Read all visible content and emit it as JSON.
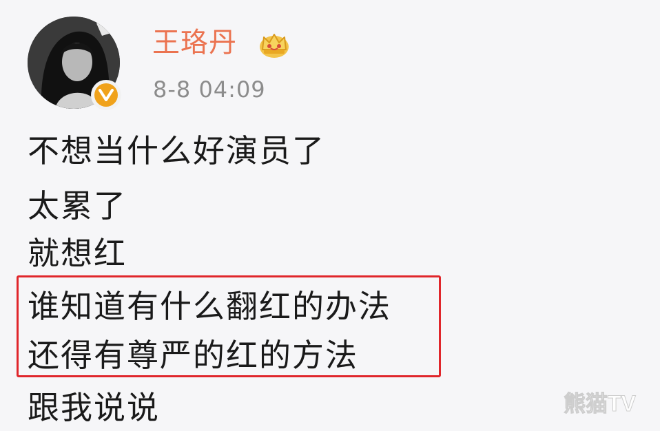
{
  "post": {
    "author": {
      "name": "王珞丹",
      "avatar": "avatar-photo",
      "verified_icon": "verified-v-icon",
      "vip_icon": "crown-icon"
    },
    "timestamp": "8-8 04:09",
    "lines": [
      "不想当什么好演员了",
      "太累了",
      "就想红",
      "谁知道有什么翻红的办法",
      "还得有尊严的红的方法",
      "跟我说说"
    ],
    "highlighted_lines": [
      3,
      4
    ]
  },
  "watermark": "熊猫TV",
  "colors": {
    "username": "#eb7350",
    "timestamp": "#8c8c8c",
    "text": "#1a1a1a",
    "highlight_border": "#e0262b",
    "verified_badge": "#f0a21b",
    "background": "#f6f6f8"
  }
}
